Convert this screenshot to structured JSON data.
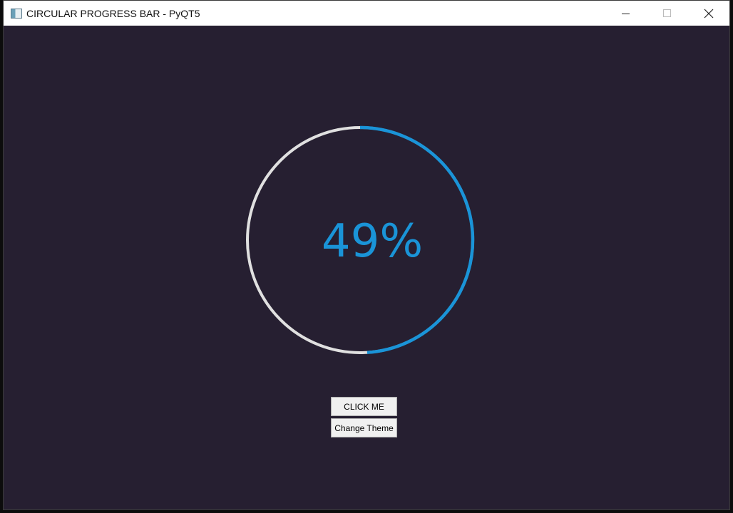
{
  "window": {
    "title": "CIRCULAR PROGRESS BAR - PyQT5"
  },
  "progress": {
    "value": 49,
    "display": "49%",
    "color": "#1a94d8",
    "track_color": "#e0e0e0"
  },
  "buttons": {
    "click_me_label": "CLICK ME",
    "change_theme_label": "Change Theme"
  },
  "colors": {
    "background": "#261f31",
    "titlebar": "#ffffff"
  }
}
